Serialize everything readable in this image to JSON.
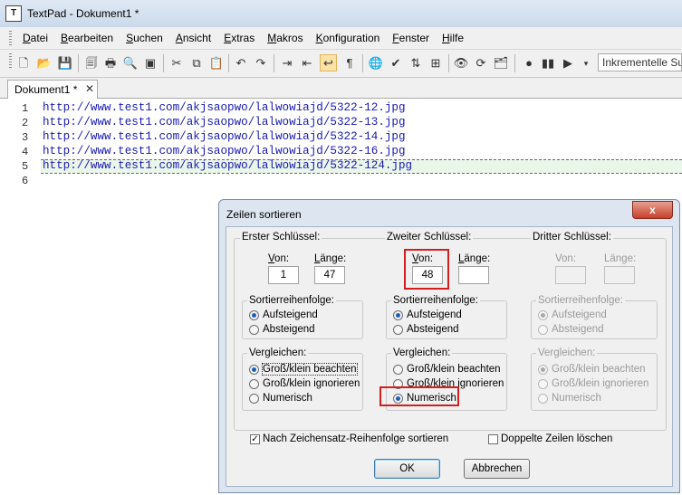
{
  "window": {
    "app_icon_glyph": "T",
    "title": "TextPad - Dokument1 *"
  },
  "menu": [
    {
      "mn": "D",
      "rest": "atei"
    },
    {
      "mn": "B",
      "rest": "earbeiten"
    },
    {
      "mn": "S",
      "rest": "uchen"
    },
    {
      "mn": "A",
      "rest": "nsicht"
    },
    {
      "mn": "E",
      "rest": "xtras"
    },
    {
      "mn": "M",
      "rest": "akros"
    },
    {
      "mn": "K",
      "rest": "onfiguration"
    },
    {
      "mn": "F",
      "rest": "enster"
    },
    {
      "mn": "H",
      "rest": "ilfe"
    }
  ],
  "toolbar": {
    "search_value": "Inkrementelle Su"
  },
  "tab": {
    "label": "Dokument1 *",
    "close_glyph": "✕"
  },
  "editor": {
    "lines": [
      {
        "num": "1",
        "text": "http://www.test1.com/akjsaopwo/lalwowiajd/5322-12.jpg"
      },
      {
        "num": "2",
        "text": "http://www.test1.com/akjsaopwo/lalwowiajd/5322-13.jpg"
      },
      {
        "num": "3",
        "text": "http://www.test1.com/akjsaopwo/lalwowiajd/5322-14.jpg"
      },
      {
        "num": "4",
        "text": "http://www.test1.com/akjsaopwo/lalwowiajd/5322-16.jpg"
      },
      {
        "num": "5",
        "text": "http://www.test1.com/akjsaopwo/lalwowiajd/5322-124.jpg"
      },
      {
        "num": "6",
        "text": ""
      }
    ],
    "current_line": 5
  },
  "dialog": {
    "title": "Zeilen sortieren",
    "close_glyph": "x",
    "keys": [
      {
        "title": "Erster Schlüssel:",
        "von_label": "Von:",
        "laenge_label": "Länge:",
        "von_value": "1",
        "laenge_value": "47",
        "order_title": "Sortierreihenfolge:",
        "order_options": [
          "Aufsteigend",
          "Absteigend"
        ],
        "order_selected": 0,
        "compare_title": "Vergleichen:",
        "compare_options": [
          "Groß/klein beachten",
          "Groß/klein ignorieren",
          "Numerisch"
        ],
        "compare_selected": 0,
        "enabled": true
      },
      {
        "title": "Zweiter Schlüssel:",
        "von_label": "Von:",
        "laenge_label": "Länge:",
        "von_value": "48",
        "laenge_value": "",
        "order_title": "Sortierreihenfolge:",
        "order_options": [
          "Aufsteigend",
          "Absteigend"
        ],
        "order_selected": 0,
        "compare_title": "Vergleichen:",
        "compare_options": [
          "Groß/klein beachten",
          "Groß/klein ignorieren",
          "Numerisch"
        ],
        "compare_selected": 2,
        "enabled": true
      },
      {
        "title": "Dritter Schlüssel:",
        "von_label": "Von:",
        "laenge_label": "Länge:",
        "von_value": "",
        "laenge_value": "",
        "order_title": "Sortierreihenfolge:",
        "order_options": [
          "Aufsteigend",
          "Absteigend"
        ],
        "order_selected": 0,
        "compare_title": "Vergleichen:",
        "compare_options": [
          "Groß/klein beachten",
          "Groß/klein ignorieren",
          "Numerisch"
        ],
        "compare_selected": 0,
        "enabled": false
      }
    ],
    "charset_sort": {
      "label": "Nach Zeichensatz-Reihenfolge sortieren",
      "checked": true
    },
    "remove_duplicates": {
      "label": "Doppelte Zeilen löschen",
      "checked": false
    },
    "ok_label": "OK",
    "cancel_label": "Abbrechen"
  },
  "colors": {
    "highlight_box": "#d21f1f",
    "url_text": "#1a1ab3",
    "radio_dot": "#1c5fb8"
  }
}
